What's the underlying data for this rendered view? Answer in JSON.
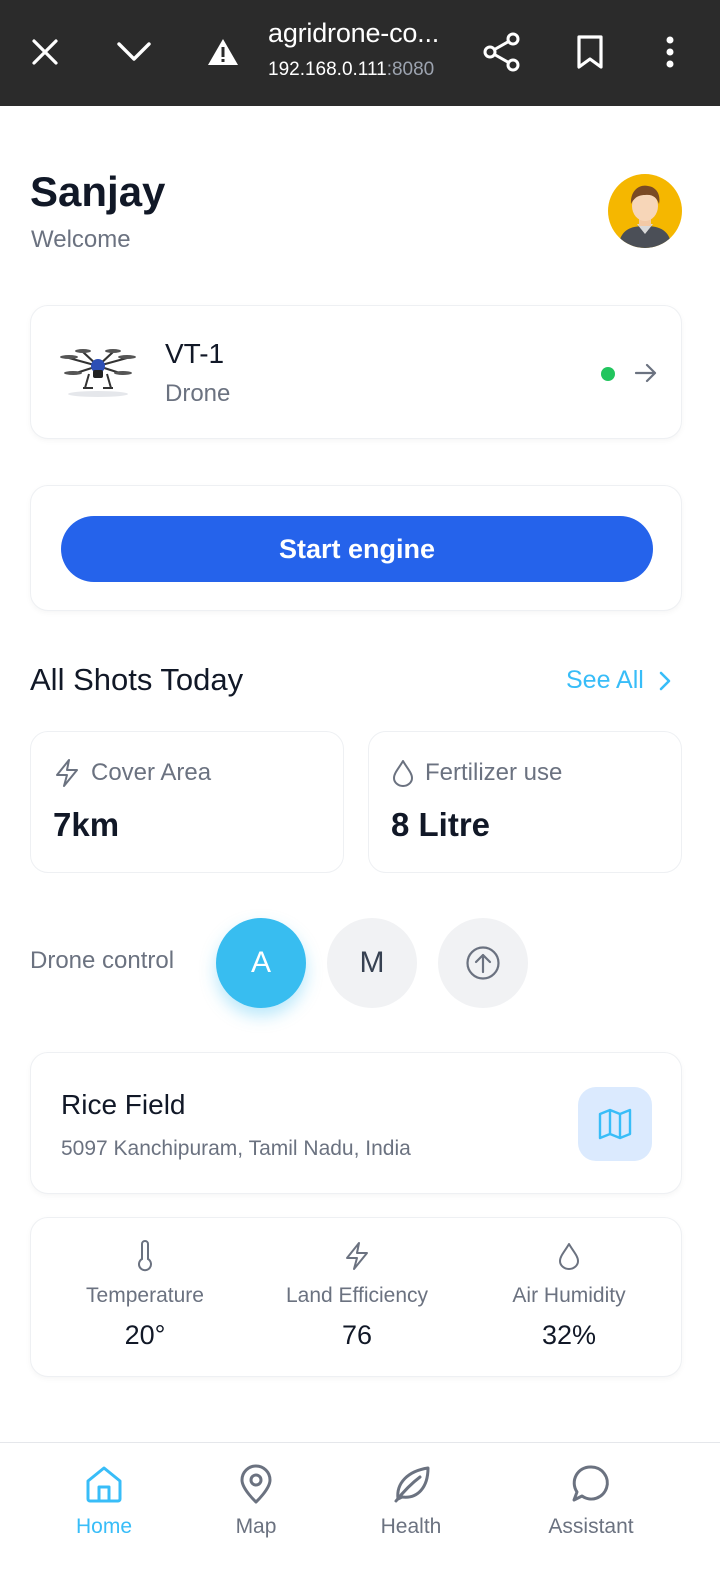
{
  "browser": {
    "title": "agridrone-co...",
    "host": "192.168.0.111",
    "port": ":8080"
  },
  "header": {
    "user_name": "Sanjay",
    "greeting": "Welcome"
  },
  "drone": {
    "name": "VT-1",
    "type": "Drone",
    "status_color": "#22c55e"
  },
  "engine": {
    "button_label": "Start engine"
  },
  "shots": {
    "title": "All Shots Today",
    "see_all": "See All",
    "cover_area": {
      "label": "Cover Area",
      "value": "7km",
      "icon": "bolt-icon"
    },
    "fertilizer": {
      "label": "Fertilizer use",
      "value": "8 Litre",
      "icon": "droplet-icon"
    }
  },
  "control": {
    "label": "Drone control",
    "modes": [
      "A",
      "M"
    ],
    "active_mode": "A"
  },
  "field": {
    "name": "Rice Field",
    "address": "5097 Kanchipuram, Tamil Nadu, India"
  },
  "metrics": [
    {
      "label": "Temperature",
      "value": "20°",
      "icon": "thermometer-icon"
    },
    {
      "label": "Land Efficiency",
      "value": "76",
      "icon": "bolt-icon"
    },
    {
      "label": "Air Humidity",
      "value": "32%",
      "icon": "droplet-icon"
    }
  ],
  "nav": [
    {
      "label": "Home",
      "icon": "home-icon",
      "active": true
    },
    {
      "label": "Map",
      "icon": "map-pin-icon",
      "active": false
    },
    {
      "label": "Health",
      "icon": "leaf-icon",
      "active": false
    },
    {
      "label": "Assistant",
      "icon": "chat-icon",
      "active": false
    }
  ],
  "colors": {
    "primary": "#2563eb",
    "accent": "#38bdf8",
    "browser_bar": "#2b2b2b"
  }
}
